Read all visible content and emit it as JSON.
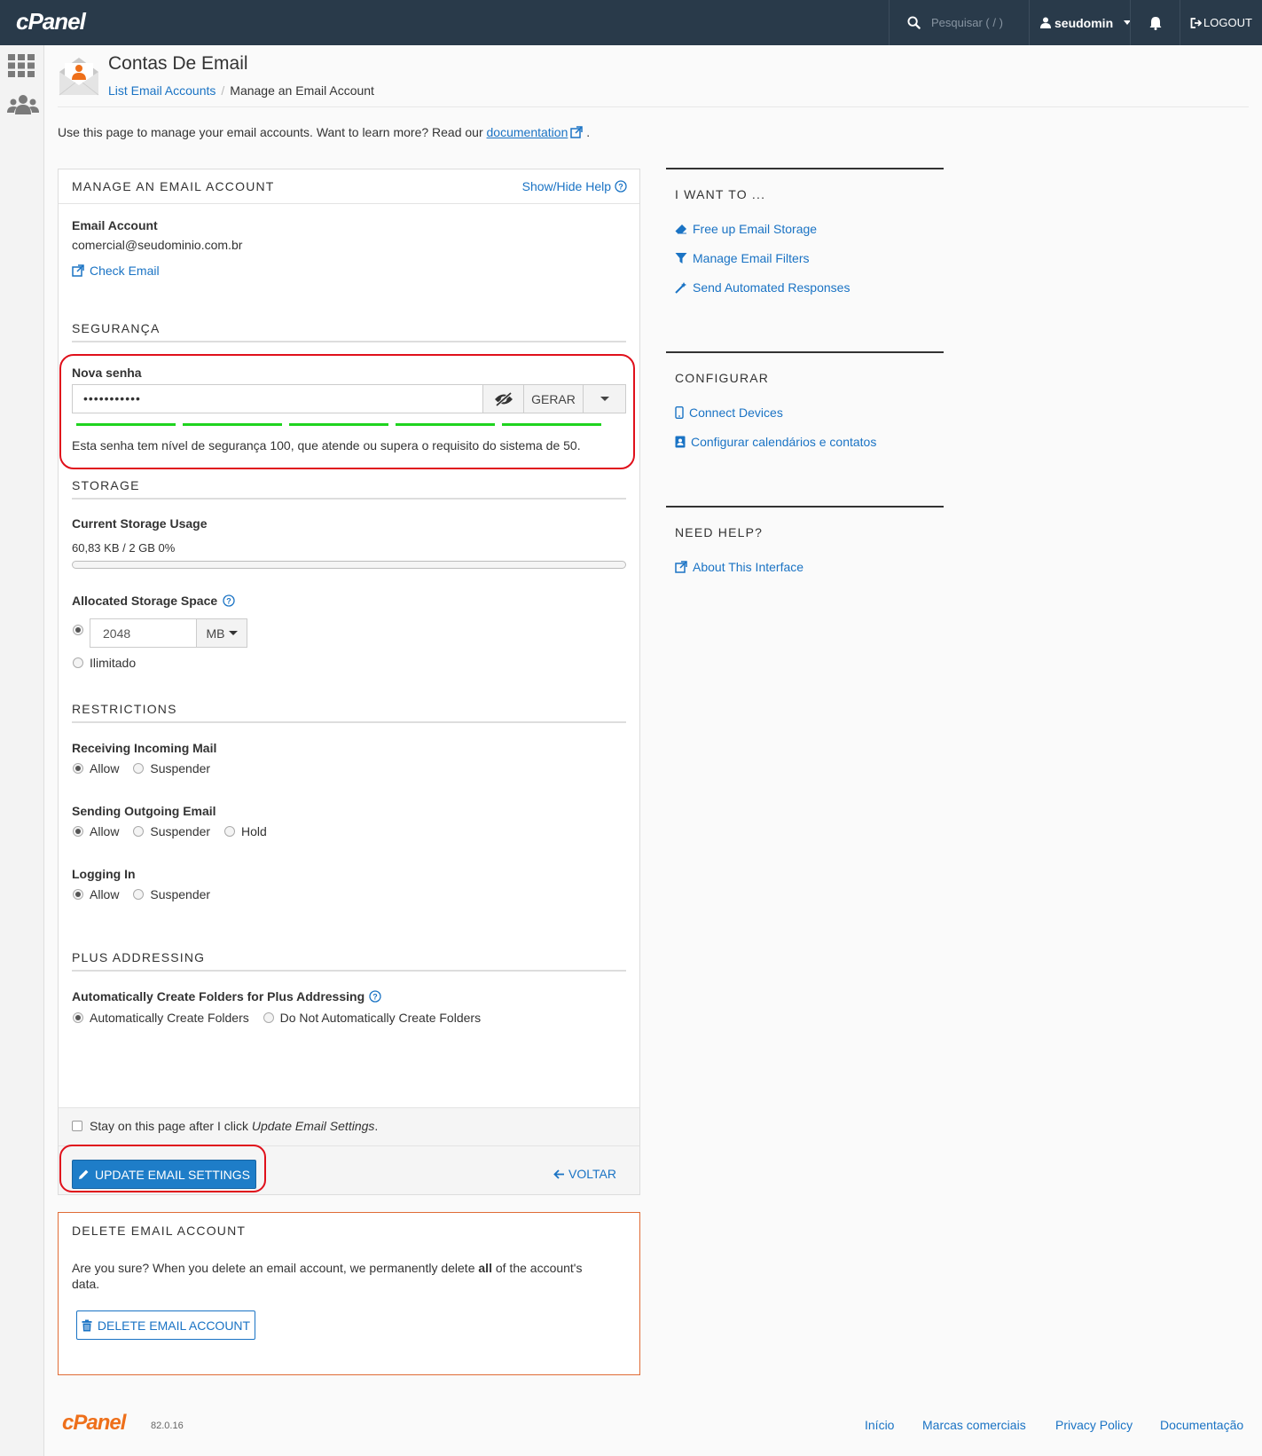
{
  "topbar": {
    "logo": "cPanel",
    "search_placeholder": "Pesquisar ( / )",
    "username": "seudomin",
    "logout": "LOGOUT"
  },
  "header": {
    "title": "Contas De Email",
    "breadcrumb": [
      "List Email Accounts",
      "Manage an Email Account"
    ]
  },
  "intro": {
    "text": "Use this page to manage your email accounts. Want to learn more? Read our",
    "link": "documentation",
    "end": "."
  },
  "manage": {
    "title": "MANAGE AN EMAIL ACCOUNT",
    "help_toggle": "Show/Hide Help",
    "email_label": "Email Account",
    "email_value": "comercial@seudominio.com.br",
    "check_email": "Check Email"
  },
  "security": {
    "title": "SEGURANÇA",
    "password_label": "Nova senha",
    "password_value": "•••••••••••",
    "generate": "GERAR",
    "strength_text": "Esta senha tem nível de segurança 100, que atende ou supera o requisito do sistema de 50.",
    "strength_value": 100,
    "strength_color": "#1fd41f"
  },
  "storage": {
    "title": "STORAGE",
    "usage_label": "Current Storage Usage",
    "usage_value": "60,83 KB / 2 GB 0%",
    "usage_percent": 0,
    "allocated_label": "Allocated Storage Space",
    "allocated_value": "2048",
    "unit": "MB",
    "unlimited": "Ilimitado"
  },
  "restrictions": {
    "title": "RESTRICTIONS",
    "incoming_label": "Receiving Incoming Mail",
    "outgoing_label": "Sending Outgoing Email",
    "login_label": "Logging In",
    "allow": "Allow",
    "suspend": "Suspender",
    "hold": "Hold"
  },
  "plus": {
    "title": "PLUS ADDRESSING",
    "label": "Automatically Create Folders for Plus Addressing",
    "auto": "Automatically Create Folders",
    "no_auto": "Do Not Automatically Create Folders"
  },
  "footer_form": {
    "stay_text": "Stay on this page after I click",
    "stay_em": "Update Email Settings",
    "stay_end": ".",
    "update": "UPDATE EMAIL SETTINGS",
    "back": "VOLTAR"
  },
  "delete": {
    "title": "DELETE EMAIL ACCOUNT",
    "text_a": "Are you sure? When you delete an email account, we permanently delete",
    "text_b": "all",
    "text_c": "of the account's data.",
    "button": "DELETE EMAIL ACCOUNT"
  },
  "sidebar_right": {
    "want_title": "I WANT TO ...",
    "want_links": [
      "Free up Email Storage",
      "Manage Email Filters",
      "Send Automated Responses"
    ],
    "config_title": "CONFIGURAR",
    "config_links": [
      "Connect Devices",
      "Configurar calendários e contatos"
    ],
    "help_title": "NEED HELP?",
    "help_links": [
      "About This Interface"
    ]
  },
  "footer": {
    "logo": "cPanel",
    "version": "82.0.16",
    "links": [
      "Início",
      "Marcas comerciais",
      "Privacy Policy",
      "Documentação"
    ]
  },
  "colors": {
    "topbar": "#293a4a",
    "link": "#1a73c4",
    "primary": "#1e7dc8",
    "highlight": "#e0101b",
    "brand_orange": "#ee6f1a"
  }
}
